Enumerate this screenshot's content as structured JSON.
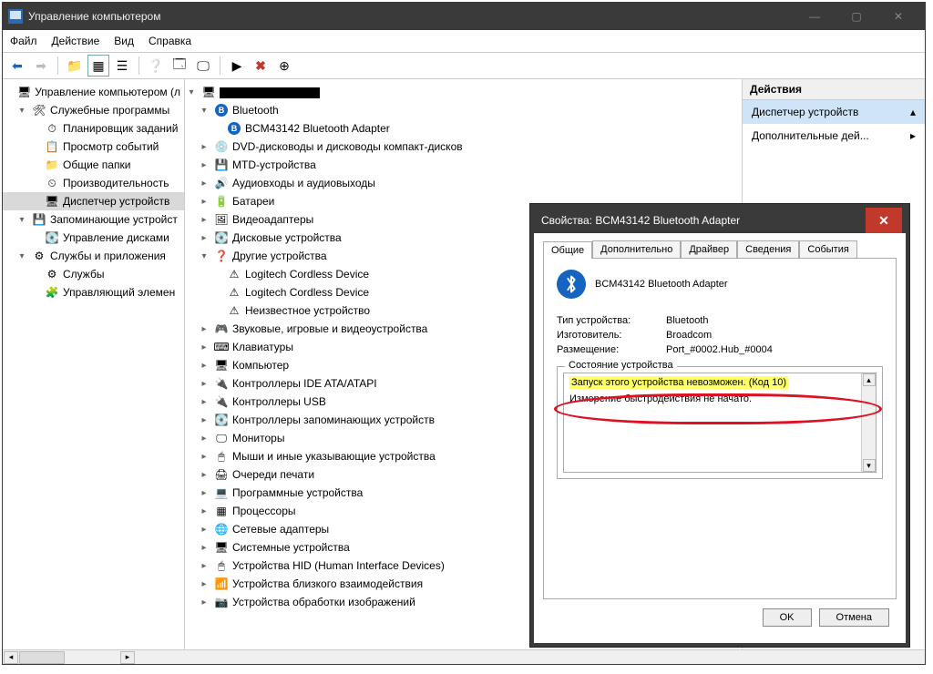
{
  "window": {
    "title": "Управление компьютером"
  },
  "menu": {
    "file": "Файл",
    "action": "Действие",
    "view": "Вид",
    "help": "Справка"
  },
  "leftTree": [
    {
      "indent": 0,
      "exp": "",
      "icon": "🖥",
      "label": "Управление компьютером (л"
    },
    {
      "indent": 1,
      "exp": "▾",
      "icon": "🛠",
      "label": "Служебные программы"
    },
    {
      "indent": 2,
      "exp": "",
      "icon": "⏱",
      "label": "Планировщик заданий"
    },
    {
      "indent": 2,
      "exp": "",
      "icon": "📋",
      "label": "Просмотр событий"
    },
    {
      "indent": 2,
      "exp": "",
      "icon": "📁",
      "label": "Общие папки"
    },
    {
      "indent": 2,
      "exp": "",
      "icon": "⏲",
      "label": "Производительность"
    },
    {
      "indent": 2,
      "exp": "",
      "icon": "🖥",
      "label": "Диспетчер устройств",
      "selected": true
    },
    {
      "indent": 1,
      "exp": "▾",
      "icon": "💾",
      "label": "Запоминающие устройст"
    },
    {
      "indent": 2,
      "exp": "",
      "icon": "💽",
      "label": "Управление дисками"
    },
    {
      "indent": 1,
      "exp": "▾",
      "icon": "⚙",
      "label": "Службы и приложения"
    },
    {
      "indent": 2,
      "exp": "",
      "icon": "⚙",
      "label": "Службы"
    },
    {
      "indent": 2,
      "exp": "",
      "icon": "🧩",
      "label": "Управляющий элемен"
    }
  ],
  "midTree": [
    {
      "indent": 0,
      "exp": "▾",
      "icon": "🖥",
      "label": "",
      "redacted": true
    },
    {
      "indent": 1,
      "exp": "▾",
      "iconColor": "#1565c0",
      "iconChar": "B",
      "label": "Bluetooth"
    },
    {
      "indent": 2,
      "exp": "",
      "iconColor": "#1565c0",
      "iconChar": "B",
      "label": "BCM43142 Bluetooth Adapter"
    },
    {
      "indent": 1,
      "exp": "▸",
      "icon": "💿",
      "label": "DVD-дисководы и дисководы компакт-дисков"
    },
    {
      "indent": 1,
      "exp": "▸",
      "icon": "💾",
      "label": "MTD-устройства"
    },
    {
      "indent": 1,
      "exp": "▸",
      "icon": "🔊",
      "label": "Аудиовходы и аудиовыходы"
    },
    {
      "indent": 1,
      "exp": "▸",
      "icon": "🔋",
      "label": "Батареи"
    },
    {
      "indent": 1,
      "exp": "▸",
      "icon": "🖼",
      "label": "Видеоадаптеры"
    },
    {
      "indent": 1,
      "exp": "▸",
      "icon": "💽",
      "label": "Дисковые устройства"
    },
    {
      "indent": 1,
      "exp": "▾",
      "icon": "❓",
      "label": "Другие устройства"
    },
    {
      "indent": 2,
      "exp": "",
      "icon": "⚠",
      "label": "Logitech Cordless Device"
    },
    {
      "indent": 2,
      "exp": "",
      "icon": "⚠",
      "label": "Logitech Cordless Device"
    },
    {
      "indent": 2,
      "exp": "",
      "icon": "⚠",
      "label": "Неизвестное устройство"
    },
    {
      "indent": 1,
      "exp": "▸",
      "icon": "🎮",
      "label": "Звуковые, игровые и видеоустройства"
    },
    {
      "indent": 1,
      "exp": "▸",
      "icon": "⌨",
      "label": "Клавиатуры"
    },
    {
      "indent": 1,
      "exp": "▸",
      "icon": "🖥",
      "label": "Компьютер"
    },
    {
      "indent": 1,
      "exp": "▸",
      "icon": "🔌",
      "label": "Контроллеры IDE ATA/ATAPI"
    },
    {
      "indent": 1,
      "exp": "▸",
      "icon": "🔌",
      "label": "Контроллеры USB"
    },
    {
      "indent": 1,
      "exp": "▸",
      "icon": "💽",
      "label": "Контроллеры запоминающих устройств"
    },
    {
      "indent": 1,
      "exp": "▸",
      "icon": "🖵",
      "label": "Мониторы"
    },
    {
      "indent": 1,
      "exp": "▸",
      "icon": "🖱",
      "label": "Мыши и иные указывающие устройства"
    },
    {
      "indent": 1,
      "exp": "▸",
      "icon": "🖨",
      "label": "Очереди печати"
    },
    {
      "indent": 1,
      "exp": "▸",
      "icon": "💻",
      "label": "Программные устройства"
    },
    {
      "indent": 1,
      "exp": "▸",
      "icon": "▦",
      "label": "Процессоры"
    },
    {
      "indent": 1,
      "exp": "▸",
      "icon": "🌐",
      "label": "Сетевые адаптеры"
    },
    {
      "indent": 1,
      "exp": "▸",
      "icon": "🖥",
      "label": "Системные устройства"
    },
    {
      "indent": 1,
      "exp": "▸",
      "icon": "🖱",
      "label": "Устройства HID (Human Interface Devices)"
    },
    {
      "indent": 1,
      "exp": "▸",
      "icon": "📶",
      "label": "Устройства близкого взаимодействия"
    },
    {
      "indent": 1,
      "exp": "▸",
      "icon": "📷",
      "label": "Устройства обработки изображений"
    }
  ],
  "actions": {
    "header": "Действия",
    "row1": "Диспетчер устройств",
    "row2": "Дополнительные дей..."
  },
  "dialog": {
    "title": "Свойства: BCM43142 Bluetooth Adapter",
    "tabs": {
      "general": "Общие",
      "more": "Дополнительно",
      "driver": "Драйвер",
      "details": "Сведения",
      "events": "События"
    },
    "deviceName": "BCM43142 Bluetooth Adapter",
    "rows": {
      "typeK": "Тип устройства:",
      "typeV": "Bluetooth",
      "mfgK": "Изготовитель:",
      "mfgV": "Broadcom",
      "locK": "Размещение:",
      "locV": "Port_#0002.Hub_#0004"
    },
    "statusLegend": "Состояние устройства",
    "statusLine1": "Запуск этого устройства невозможен. (Код 10)",
    "statusLine2": "Измерение быстродействия не начато.",
    "ok": "OK",
    "cancel": "Отмена"
  }
}
